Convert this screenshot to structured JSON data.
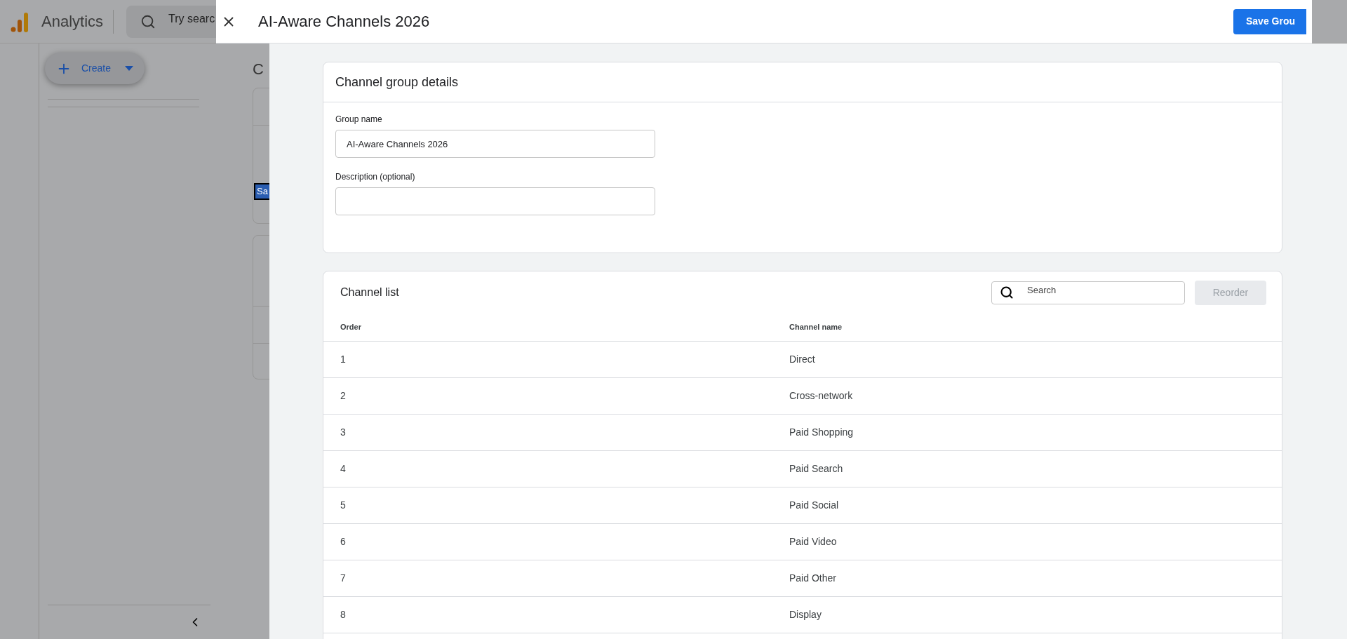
{
  "background": {
    "app_name": "Analytics",
    "search_placeholder": "Try searc",
    "create_button": "Create",
    "page_title": "C",
    "selected_label": "Sa"
  },
  "dialog": {
    "title": "AI-Aware Channels 2026",
    "save_button": "Save Grou",
    "details": {
      "title": "Channel group details",
      "fields": [
        {
          "label": "Group name",
          "value": "AI-Aware Channels 2026"
        },
        {
          "label": "Description (optional)"
        }
      ]
    },
    "channel_list": {
      "title": "Channel list",
      "search_placeholder": "Search",
      "reorder_button": {
        "label": "Reorder",
        "disabled": true
      },
      "columns": [
        "Order",
        "Channel name"
      ],
      "rows": [
        {
          "order": "1",
          "name": "Direct"
        },
        {
          "order": "2",
          "name": "Cross-network"
        },
        {
          "order": "3",
          "name": "Paid Shopping"
        },
        {
          "order": "4",
          "name": "Paid Search"
        },
        {
          "order": "5",
          "name": "Paid Social"
        },
        {
          "order": "6",
          "name": "Paid Video"
        },
        {
          "order": "7",
          "name": "Paid Other"
        },
        {
          "order": "8",
          "name": "Display"
        }
      ]
    }
  }
}
